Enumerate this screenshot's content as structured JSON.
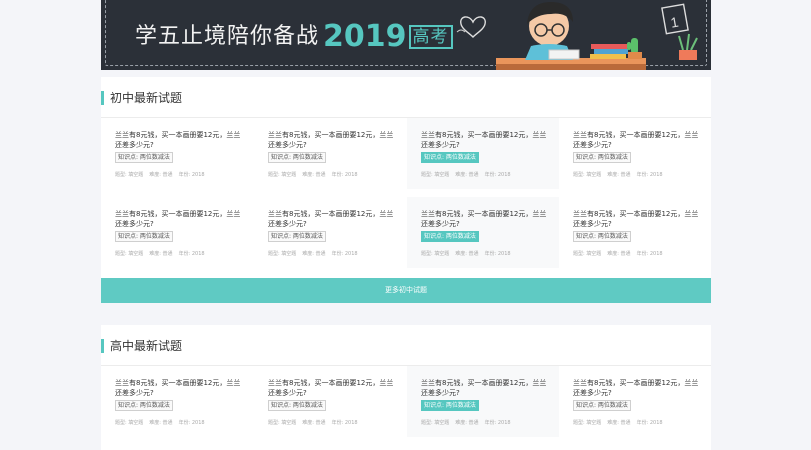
{
  "banner": {
    "title": "学五止境陪你备战",
    "year": "2019",
    "badge": "高考",
    "calendar_number": "1"
  },
  "colors": {
    "accent": "#56c7c0",
    "more_button": "#5fcac3",
    "banner_bg": "#2b3038"
  },
  "sections": [
    {
      "title": "初中最新试题",
      "more_label": "更多初中试题",
      "rows": [
        [
          {
            "q": "兰兰有8元钱，买一本画册要12元，兰兰还差多少元?",
            "tag": "知识点: 两位数减法",
            "type": "题型: 填空题",
            "diff": "难度: 普通",
            "year": "年份: 2018"
          },
          {
            "q": "兰兰有8元钱，买一本画册要12元，兰兰还差多少元?",
            "tag": "知识点: 两位数减法",
            "type": "题型: 填空题",
            "diff": "难度: 普通",
            "year": "年份: 2018"
          },
          {
            "q": "兰兰有8元钱，买一本画册要12元，兰兰还差多少元?",
            "tag": "知识点: 两位数减法",
            "type": "题型: 填空题",
            "diff": "难度: 普通",
            "year": "年份: 2018"
          },
          {
            "q": "兰兰有8元钱，买一本画册要12元，兰兰还差多少元?",
            "tag": "知识点: 两位数减法",
            "type": "题型: 填空题",
            "diff": "难度: 普通",
            "year": "年份: 2018"
          }
        ],
        [
          {
            "q": "兰兰有8元钱，买一本画册要12元，兰兰还差多少元?",
            "tag": "知识点: 两位数减法",
            "type": "题型: 填空题",
            "diff": "难度: 普通",
            "year": "年份: 2018"
          },
          {
            "q": "兰兰有8元钱，买一本画册要12元，兰兰还差多少元?",
            "tag": "知识点: 两位数减法",
            "type": "题型: 填空题",
            "diff": "难度: 普通",
            "year": "年份: 2018"
          },
          {
            "q": "兰兰有8元钱，买一本画册要12元，兰兰还差多少元?",
            "tag": "知识点: 两位数减法",
            "type": "题型: 填空题",
            "diff": "难度: 普通",
            "year": "年份: 2018"
          },
          {
            "q": "兰兰有8元钱，买一本画册要12元，兰兰还差多少元?",
            "tag": "知识点: 两位数减法",
            "type": "题型: 填空题",
            "diff": "难度: 普通",
            "year": "年份: 2018"
          }
        ]
      ]
    },
    {
      "title": "高中最新试题",
      "rows": [
        [
          {
            "q": "兰兰有8元钱，买一本画册要12元，兰兰还差多少元?",
            "tag": "知识点: 两位数减法",
            "type": "题型: 填空题",
            "diff": "难度: 普通",
            "year": "年份: 2018"
          },
          {
            "q": "兰兰有8元钱，买一本画册要12元，兰兰还差多少元?",
            "tag": "知识点: 两位数减法",
            "type": "题型: 填空题",
            "diff": "难度: 普通",
            "year": "年份: 2018"
          },
          {
            "q": "兰兰有8元钱，买一本画册要12元，兰兰还差多少元?",
            "tag": "知识点: 两位数减法",
            "type": "题型: 填空题",
            "diff": "难度: 普通",
            "year": "年份: 2018"
          },
          {
            "q": "兰兰有8元钱，买一本画册要12元，兰兰还差多少元?",
            "tag": "知识点: 两位数减法",
            "type": "题型: 填空题",
            "diff": "难度: 普通",
            "year": "年份: 2018"
          }
        ]
      ]
    }
  ]
}
